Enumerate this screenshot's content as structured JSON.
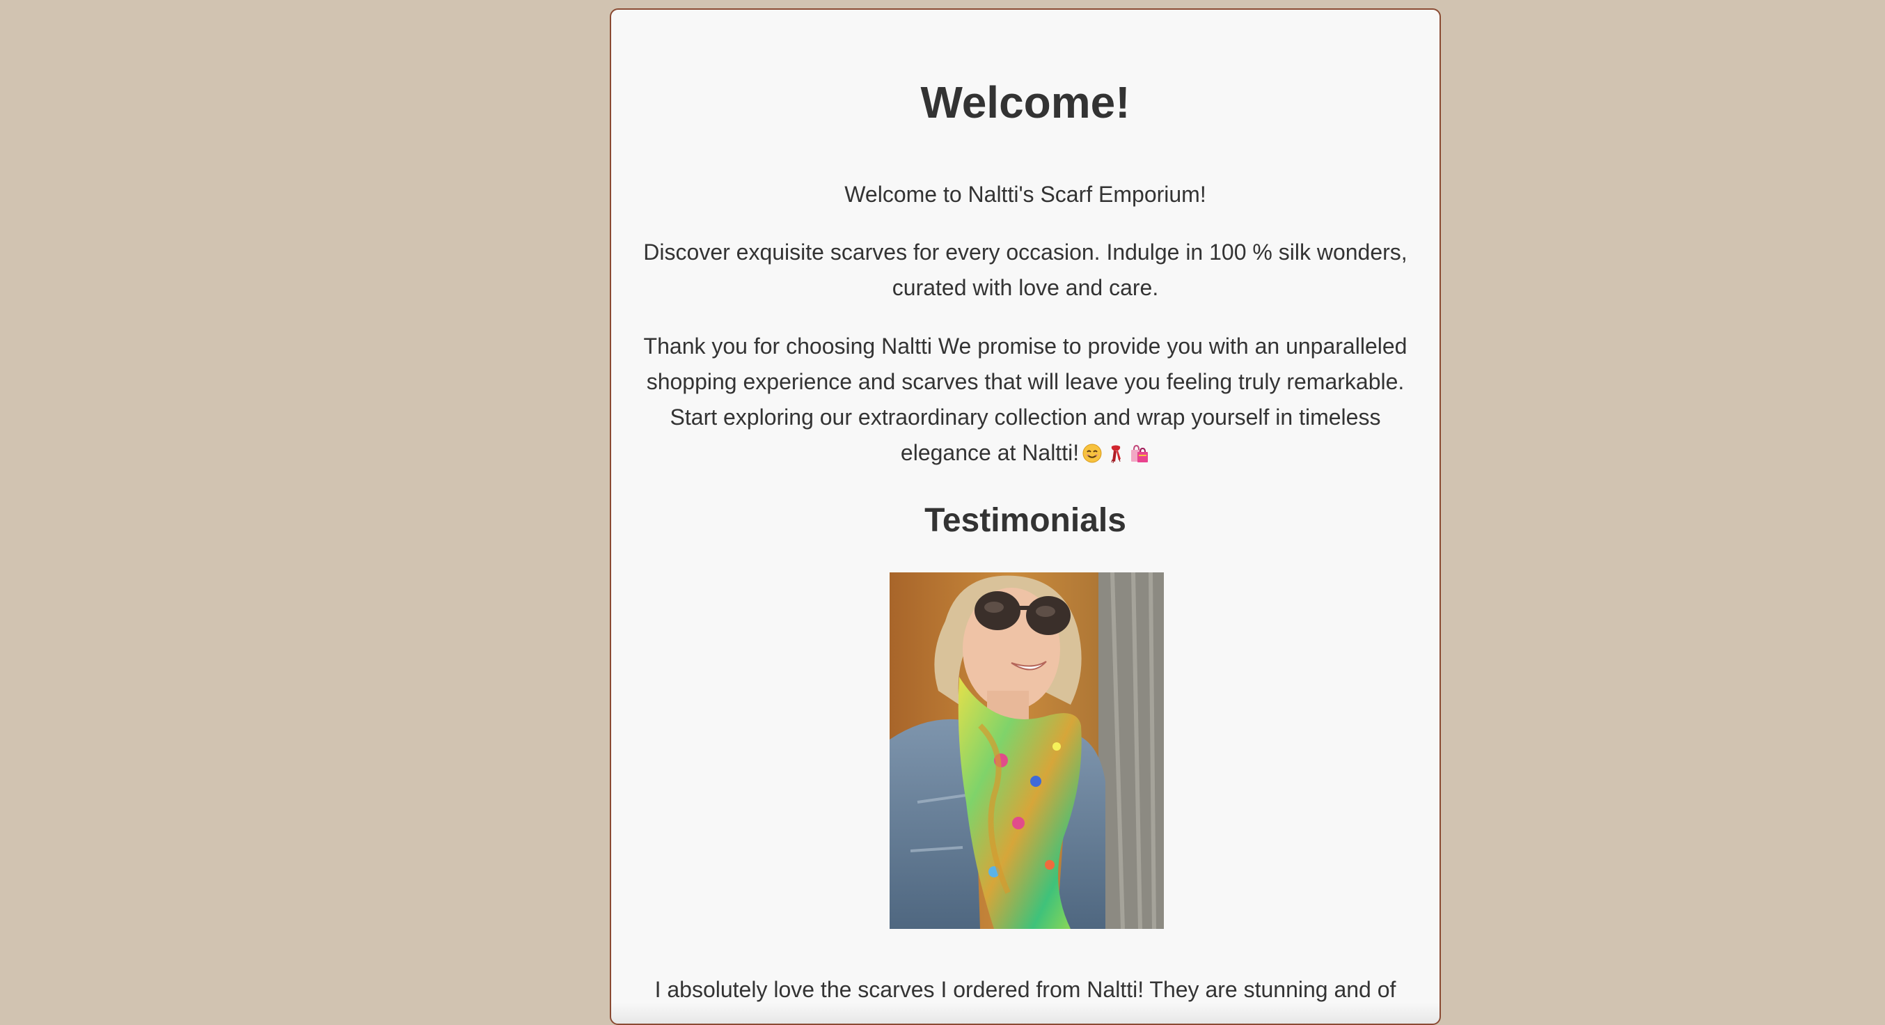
{
  "welcome": {
    "title": "Welcome!",
    "intro": "Welcome to Naltti's Scarf Emporium!",
    "discover": "Discover exquisite scarves for every occasion. Indulge in 100 % silk wonders, curated with love and care.",
    "thanks": "Thank you for choosing Naltti We promise to provide you with an unparalleled shopping experience and scarves that will leave you feeling truly remarkable. Start exploring our extraordinary collection and wrap yourself in timeless elegance at Naltti!",
    "emojis": [
      "smiling-face-icon",
      "scarf-icon",
      "shopping-bags-icon"
    ]
  },
  "testimonials": {
    "heading": "Testimonials",
    "photo_icon": "testimonial-photo",
    "quote_start": "I absolutely love the scarves I ordered from Naltti! They are stunning and of"
  },
  "colors": {
    "page_background": "#d1c3b1",
    "card_background": "#f8f8f8",
    "card_border": "#8a4a32",
    "text": "#333333"
  }
}
